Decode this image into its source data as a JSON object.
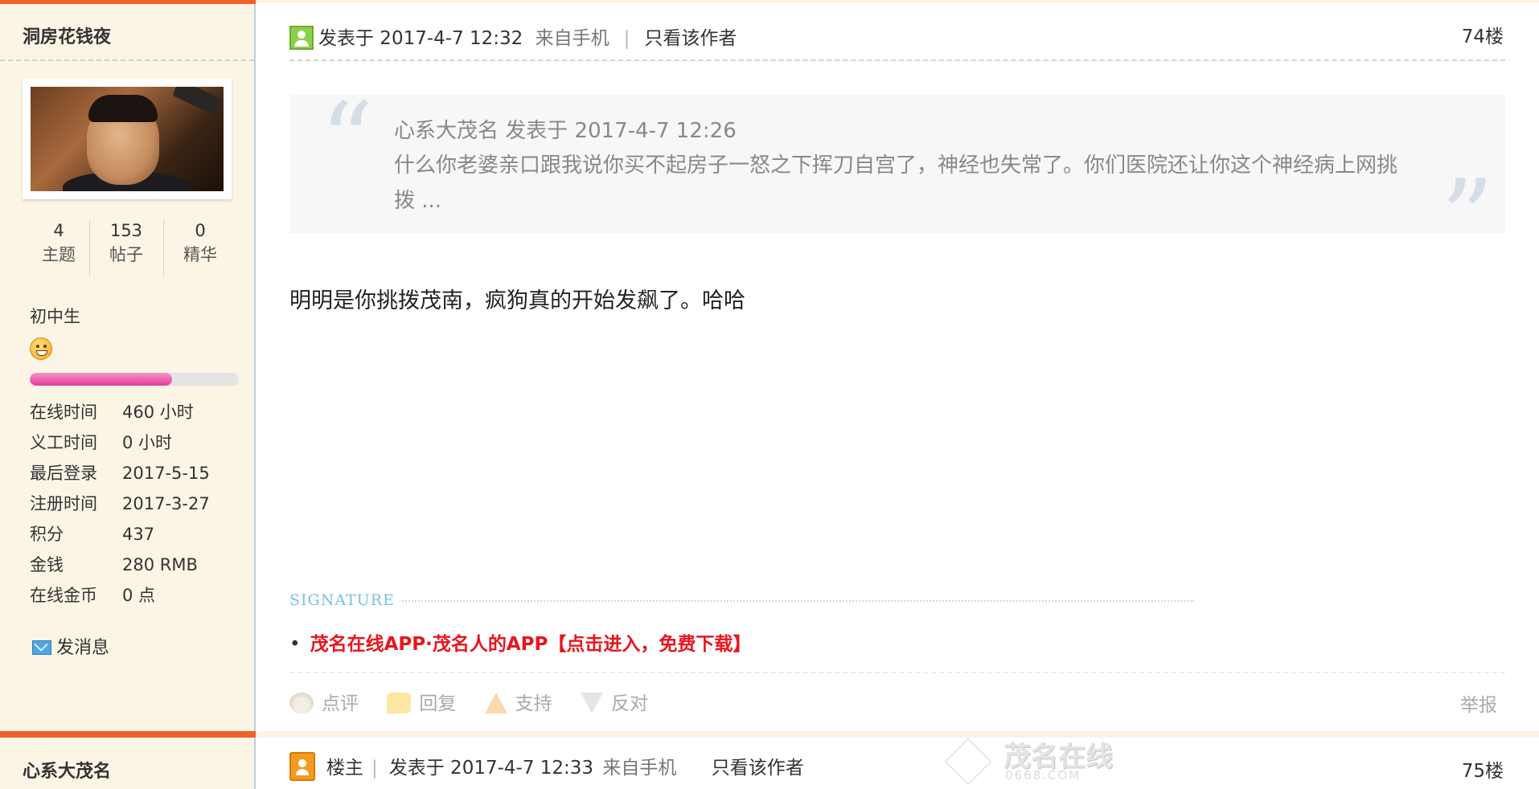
{
  "user1": {
    "name": "洞房花钱夜",
    "stats": [
      {
        "num": "4",
        "label": "主题"
      },
      {
        "num": "153",
        "label": "帖子"
      },
      {
        "num": "0",
        "label": "精华"
      }
    ],
    "rank": "初中生",
    "progress_fraction": 0.68,
    "info": [
      {
        "k": "在线时间",
        "v": "460 小时"
      },
      {
        "k": "义工时间",
        "v": "0 小时"
      },
      {
        "k": "最后登录",
        "v": "2017-5-15"
      },
      {
        "k": "注册时间",
        "v": "2017-3-27"
      },
      {
        "k": "积分",
        "v": "437"
      },
      {
        "k": "金钱",
        "v": "280 RMB"
      },
      {
        "k": "在线金币",
        "v": "0 点"
      }
    ],
    "send_message": "发消息"
  },
  "user2": {
    "name": "心系大茂名"
  },
  "post1": {
    "posted": "发表于 2017-4-7 12:32",
    "source": "来自手机",
    "only_author": "只看该作者",
    "floor": "74楼",
    "quote_author": "心系大茂名 发表于 2017-4-7 12:26",
    "quote_text": "什么你老婆亲口跟我说你买不起房子一怒之下挥刀自宫了，神经也失常了。你们医院还让你这个神经病上网挑拨 ...",
    "content": "明明是你挑拨茂南，疯狗真的开始发飙了。哈哈",
    "signature_label": "SIGNATURE",
    "signature_link": "茂名在线APP·茂名人的APP【点击进入，免费下载】",
    "actions": {
      "review": "点评",
      "reply": "回复",
      "support": "支持",
      "oppose": "反对",
      "report": "举报"
    }
  },
  "post2": {
    "owner": "楼主",
    "posted": "发表于 2017-4-7 12:33",
    "source": "来自手机",
    "only_author": "只看该作者",
    "floor": "75楼"
  },
  "watermark": {
    "text": "茂名在线",
    "sub": "0668.COM"
  },
  "colors": {
    "accent": "#f35e2c",
    "sidebar_bg": "#fcf5e6",
    "signature_link": "#e8151e",
    "quote_mark": "#d5dee8"
  }
}
